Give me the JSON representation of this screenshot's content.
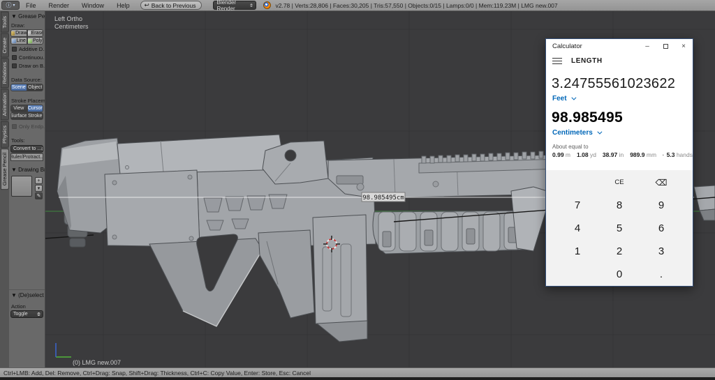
{
  "blender": {
    "topbar": {
      "editor_icon": "info-editor",
      "menus": [
        "File",
        "Render",
        "Window",
        "Help"
      ],
      "back_button": "Back to Previous",
      "engine_select": "Blender Render",
      "stats": "v2.78 | Verts:28,806 | Faces:30,205 | Tris:57,550 | Objects:0/15 | Lamps:0/0 | Mem:119.23M | LMG new.007"
    },
    "tabs": [
      "Tools",
      "Create",
      "Relations",
      "Animation",
      "Physics",
      "Grease Pencil"
    ],
    "active_tab": "Grease Pencil",
    "shelf": {
      "panel1_title": "▼ Grease Pencil",
      "draw_label": "Draw:",
      "btn_draw": "Draw",
      "btn_erase": "Erase",
      "btn_line": "Line",
      "btn_poly": "Poly",
      "chk1": "Additive D...",
      "chk2": "Continuou...",
      "chk3": "Draw on B...",
      "data_source_label": "Data Source:",
      "btn_scene": "Scene",
      "btn_object": "Object",
      "stroke_label": "Stroke Placem...",
      "btn_view": "View",
      "btn_cursor": "Cursor",
      "btn_surface": "Surface",
      "btn_stroke": "Stroke",
      "chk_endpoints": "Only Endp...",
      "tools_label": "Tools:",
      "convert_dd": "Convert to ...",
      "ruler_btn": "Ruler/Protract...",
      "panel2_title": "▼ Drawing Brush",
      "panel3_title": "▼ (De)select All",
      "action_label": "Action",
      "action_value": "Toggle"
    },
    "viewport": {
      "view_label": "Left Ortho",
      "unit_label": "Centimeters",
      "object_label": "(0) LMG new.007",
      "ruler_value": "98.985495cm"
    },
    "statusbar": "Ctrl+LMB: Add, Del: Remove, Ctrl+Drag: Snap, Shift+Drag: Thickness, Ctrl+C: Copy Value, Enter: Store,  Esc: Cancel"
  },
  "calculator": {
    "title": "Calculator",
    "mode": "LENGTH",
    "input_value": "3.24755561023622",
    "input_unit": "Feet",
    "output_value": "98.985495",
    "output_unit": "Centimeters",
    "about_label": "About equal to",
    "equivalents": [
      {
        "value": "0.99",
        "unit": "m"
      },
      {
        "value": "1.08",
        "unit": "yd"
      },
      {
        "value": "38.97",
        "unit": "in"
      },
      {
        "value": "989.9",
        "unit": "mm"
      },
      {
        "value": "5.3",
        "unit": "hands"
      }
    ],
    "keypad": [
      [
        "",
        "CE",
        "⌫"
      ],
      [
        "7",
        "8",
        "9"
      ],
      [
        "4",
        "5",
        "6"
      ],
      [
        "1",
        "2",
        "3"
      ],
      [
        "",
        "0",
        "."
      ]
    ],
    "accent_color": "#0067b8"
  }
}
